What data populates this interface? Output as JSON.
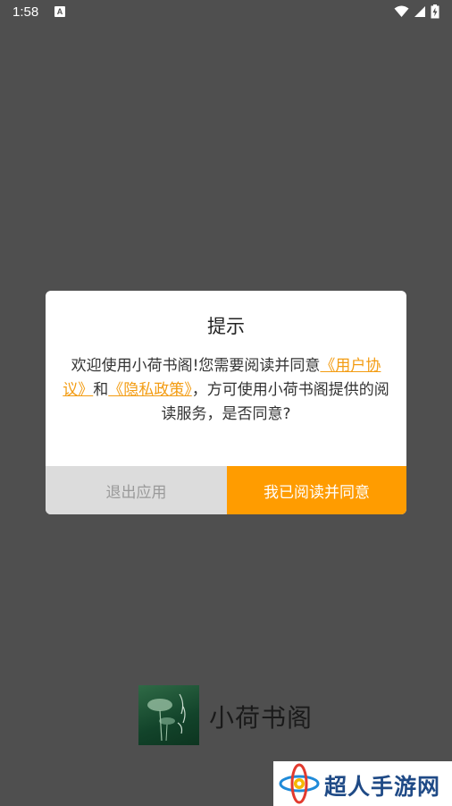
{
  "status_bar": {
    "time": "1:58",
    "notification_icon": "A"
  },
  "dialog": {
    "title": "提示",
    "body_part1": "欢迎使用小荷书阁!您需要阅读并同意",
    "link_user_agreement": "《用户协议》",
    "body_part2": "和",
    "link_privacy_policy": "《隐私政策》",
    "body_part3": "，方可使用小荷书阁提供的阅读服务，是否同意?",
    "exit_button": "退出应用",
    "agree_button": "我已阅读并同意"
  },
  "app": {
    "name": "小荷书阁"
  },
  "watermark": {
    "text": "超人手游网"
  },
  "colors": {
    "overlay": "#4f4f4f",
    "accent": "#ff9c00",
    "link": "#f39c12"
  }
}
